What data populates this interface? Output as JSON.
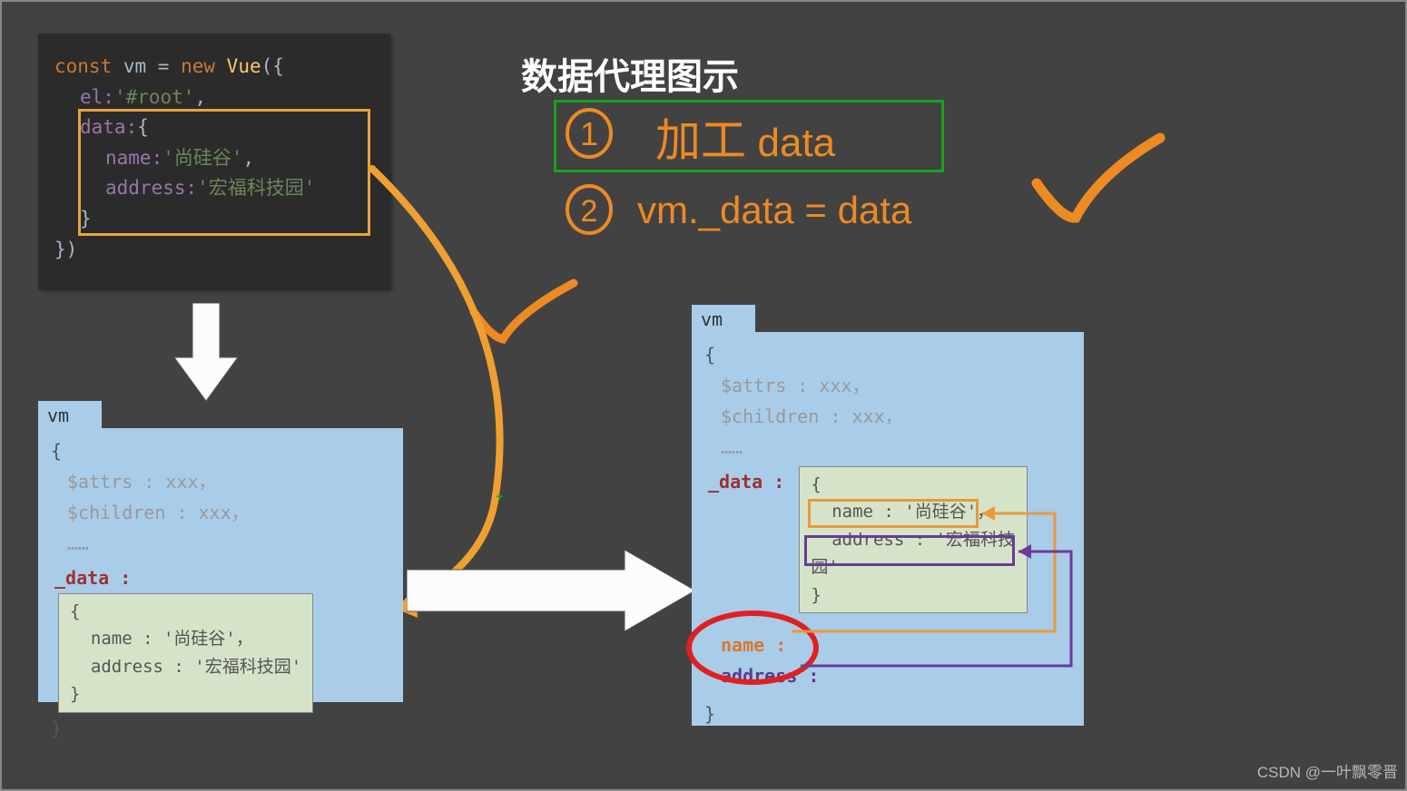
{
  "title": "数据代理图示",
  "code": {
    "line1_kw": "const ",
    "line1_var": "vm ",
    "line1_eq": "= ",
    "line1_new": "new ",
    "line1_cls": "Vue",
    "line1_paren": "({",
    "line2_prop": "el:",
    "line2_val": "'#root'",
    "line2_comma": ",",
    "line3_prop": "data:",
    "line3_brace": "{",
    "line4_prop": "name:",
    "line4_val": "'尚硅谷'",
    "line4_comma": ",",
    "line5_prop": "address:",
    "line5_val": "'宏福科技园'",
    "line6": "}",
    "line7": "})"
  },
  "step1": {
    "num": "1",
    "text_cn": "加工 ",
    "text_en": "data"
  },
  "step2": {
    "num": "2",
    "text": "vm._data = data"
  },
  "vm": {
    "label": "vm",
    "open": "{",
    "attrs": "$attrs : xxx，",
    "children": "$children : xxx，",
    "dots": "……",
    "data_label": "_data : ",
    "data_open": "{",
    "data_name": "name : '尚硅谷'，",
    "data_addr": "address : '宏福科技园'",
    "data_close": "}",
    "close": "}",
    "proxy_name": "name : ",
    "proxy_addr": "address : "
  },
  "watermark": "CSDN @一叶飘零晋",
  "cross": "+"
}
